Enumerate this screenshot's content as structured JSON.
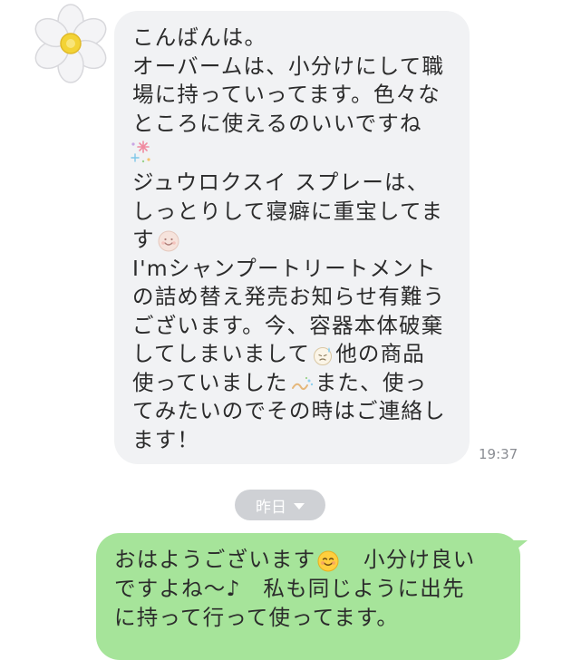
{
  "incoming_message": {
    "lines_top": [
      "こんばんは。",
      "オーバームは、小分けにして職",
      "場に持っていってます。色々な",
      "ところに使えるのいいですね"
    ],
    "lines_mid": [
      "ジュウロクスイ スプレーは、",
      "しっとりして寝癖に重宝してま"
    ],
    "line_su": "す",
    "lines_cont": [
      "I'mシャンプートリートメント",
      "の詰め替え発売お知らせ有難う",
      "ございます。今、容器本体破棄"
    ],
    "line_shite": "してしまいまして",
    "line_shite_after": "他の商品",
    "line_tsukatte": "使っていました",
    "line_tsukatte_after": "また、使っ",
    "lines_end": [
      "てみたいのでその時はご連絡し",
      "ます！"
    ],
    "time": "19:37"
  },
  "date_separator": {
    "label": "昨日"
  },
  "outgoing_message": {
    "line1_a": "おはようございます",
    "line1_b": "　小分け良い",
    "line2": "ですよね〜♪　私も同じように出先",
    "line3": "に持って行って使ってます。"
  },
  "icons": {
    "avatar": "white-daisy-flower-avatar",
    "sparkle": "sparkle-emoji",
    "smile": "smile-face-emoji",
    "sweat": "sweat-face-emoji",
    "wave": "wave-emoji",
    "blush": "smiling-face-emoji",
    "dropdown": "chevron-down-icon"
  },
  "colors": {
    "incoming_bubble": "#f1f2f4",
    "outgoing_bubble": "#a6e49a",
    "date_pill": "#cfd1d5",
    "timestamp": "#8a8d93"
  }
}
